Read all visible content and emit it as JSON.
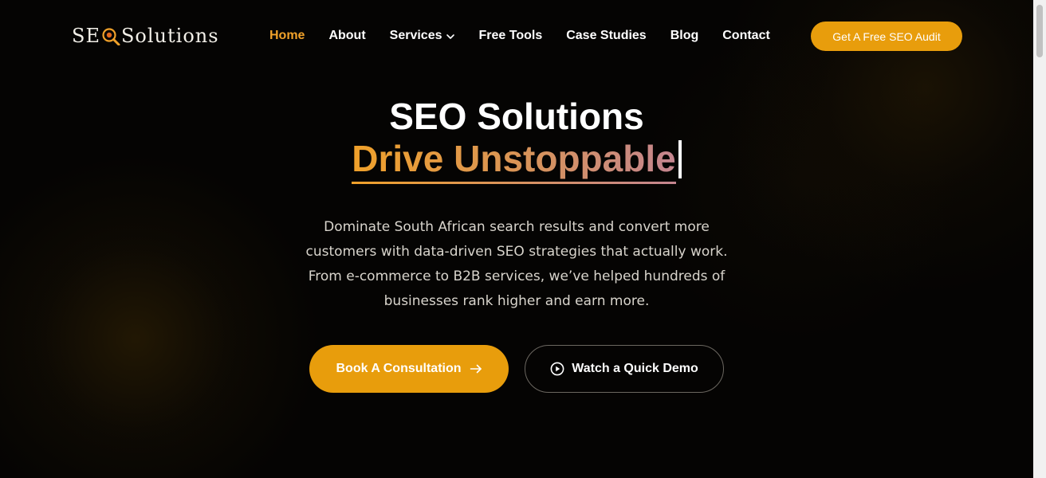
{
  "logo": {
    "text_before": "SE",
    "text_after": "Solutions",
    "icon": "magnifier-icon"
  },
  "nav": {
    "items": [
      {
        "label": "Home",
        "active": true
      },
      {
        "label": "About"
      },
      {
        "label": "Services",
        "icon": "chevron-down-icon"
      },
      {
        "label": "Free Tools"
      },
      {
        "label": "Case Studies"
      },
      {
        "label": "Blog"
      },
      {
        "label": "Contact"
      }
    ],
    "cta_label": "Get A Free SEO Audit"
  },
  "hero": {
    "title": "SEO Solutions",
    "typed_text": "Drive Unstoppable",
    "description_lines": [
      "Dominate South African search results and convert more",
      "customers with data-driven SEO strategies that actually work.",
      "From e-commerce to B2B services, we’ve helped hundreds of",
      "businesses rank higher and earn more."
    ],
    "primary_button": {
      "label": "Book A Consultation",
      "icon": "arrow-right-icon"
    },
    "secondary_button": {
      "label": "Watch a Quick Demo",
      "icon": "play-circle-icon"
    }
  },
  "colors": {
    "accent": "#e89d0c",
    "active_nav": "#f0a12a",
    "background": "#050403",
    "gradient_end": "#c48590"
  }
}
